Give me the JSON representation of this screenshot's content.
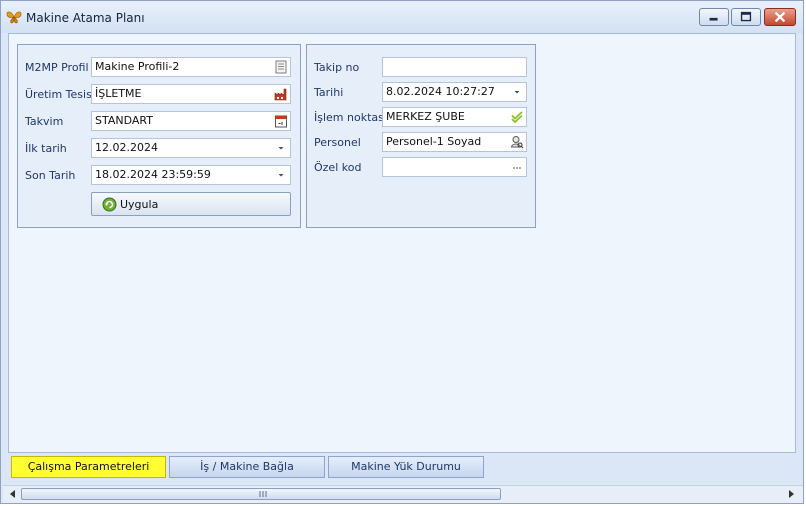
{
  "window": {
    "title": "Makine Atama Planı"
  },
  "left_panel": {
    "fields": [
      {
        "label": "M2MP Profil",
        "value": "Makine Profili-2",
        "button_icon": "list-icon"
      },
      {
        "label": "Üretim Tesisi",
        "value": "İŞLETME",
        "button_icon": "factory-icon"
      },
      {
        "label": "Takvim",
        "value": "STANDART",
        "button_icon": "calendar-icon"
      },
      {
        "label": "İlk tarih",
        "value": "12.02.2024",
        "button_icon": "dropdown-arrow-icon"
      },
      {
        "label": "Son Tarih",
        "value": "18.02.2024 23:59:59",
        "button_icon": "dropdown-arrow-icon"
      }
    ],
    "apply_button": "Uygula"
  },
  "right_panel": {
    "fields": [
      {
        "label": "Takip no",
        "value": ""
      },
      {
        "label": "Tarihi",
        "value": "8.02.2024 10:27:27",
        "button_icon": "dropdown-arrow-icon"
      },
      {
        "label": "İşlem noktası",
        "value": "MERKEZ ŞUBE",
        "button_icon": "check-icon"
      },
      {
        "label": "Personel",
        "value": "Personel-1 Soyad",
        "button_icon": "person-lookup-icon"
      },
      {
        "label": "Özel kod",
        "value": "",
        "button_icon": "ellipsis-icon"
      }
    ]
  },
  "tabs": [
    {
      "label": "Çalışma Parametreleri",
      "active": true
    },
    {
      "label": "İş / Makine Bağla",
      "active": false
    },
    {
      "label": "Makine Yük Durumu",
      "active": false
    }
  ],
  "colors": {
    "active_tab": "#ffff33",
    "title_bg": "#dbe7f7",
    "close_button": "#c64530"
  }
}
